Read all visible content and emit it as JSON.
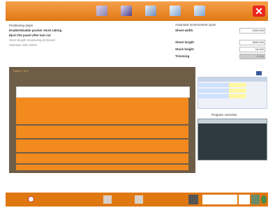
{
  "close_symbol": "✕",
  "toolbar_icons": [
    "cut-pattern-icon",
    "stack-icon",
    "tools-icon",
    "monitor-icon",
    "display-icon"
  ],
  "options": {
    "items": [
      "Positioning stops",
      "Enable/disable pusher stock taking",
      "Eject the panel after last cut",
      "Store length measuring enclosed",
      "Operator with assist"
    ]
  },
  "params": {
    "header": "Automatic Environment cycle",
    "sheet_width_label": "Sheet width",
    "sheet_width_value": "2000.000",
    "sheet_length_label": "Sheet length",
    "sheet_length_value": "3600.000",
    "stack_height_label": "Stack height",
    "stack_height_value": "18.000",
    "trimming_label": "Trimming",
    "trimming_value": "0.000"
  },
  "preview": {
    "title": "Sheet 1 of 3"
  },
  "side": {
    "progress_title": "Program overview"
  },
  "colors": {
    "accent": "#e07812",
    "panel": "#6e5e48",
    "close": "#e8261e"
  }
}
